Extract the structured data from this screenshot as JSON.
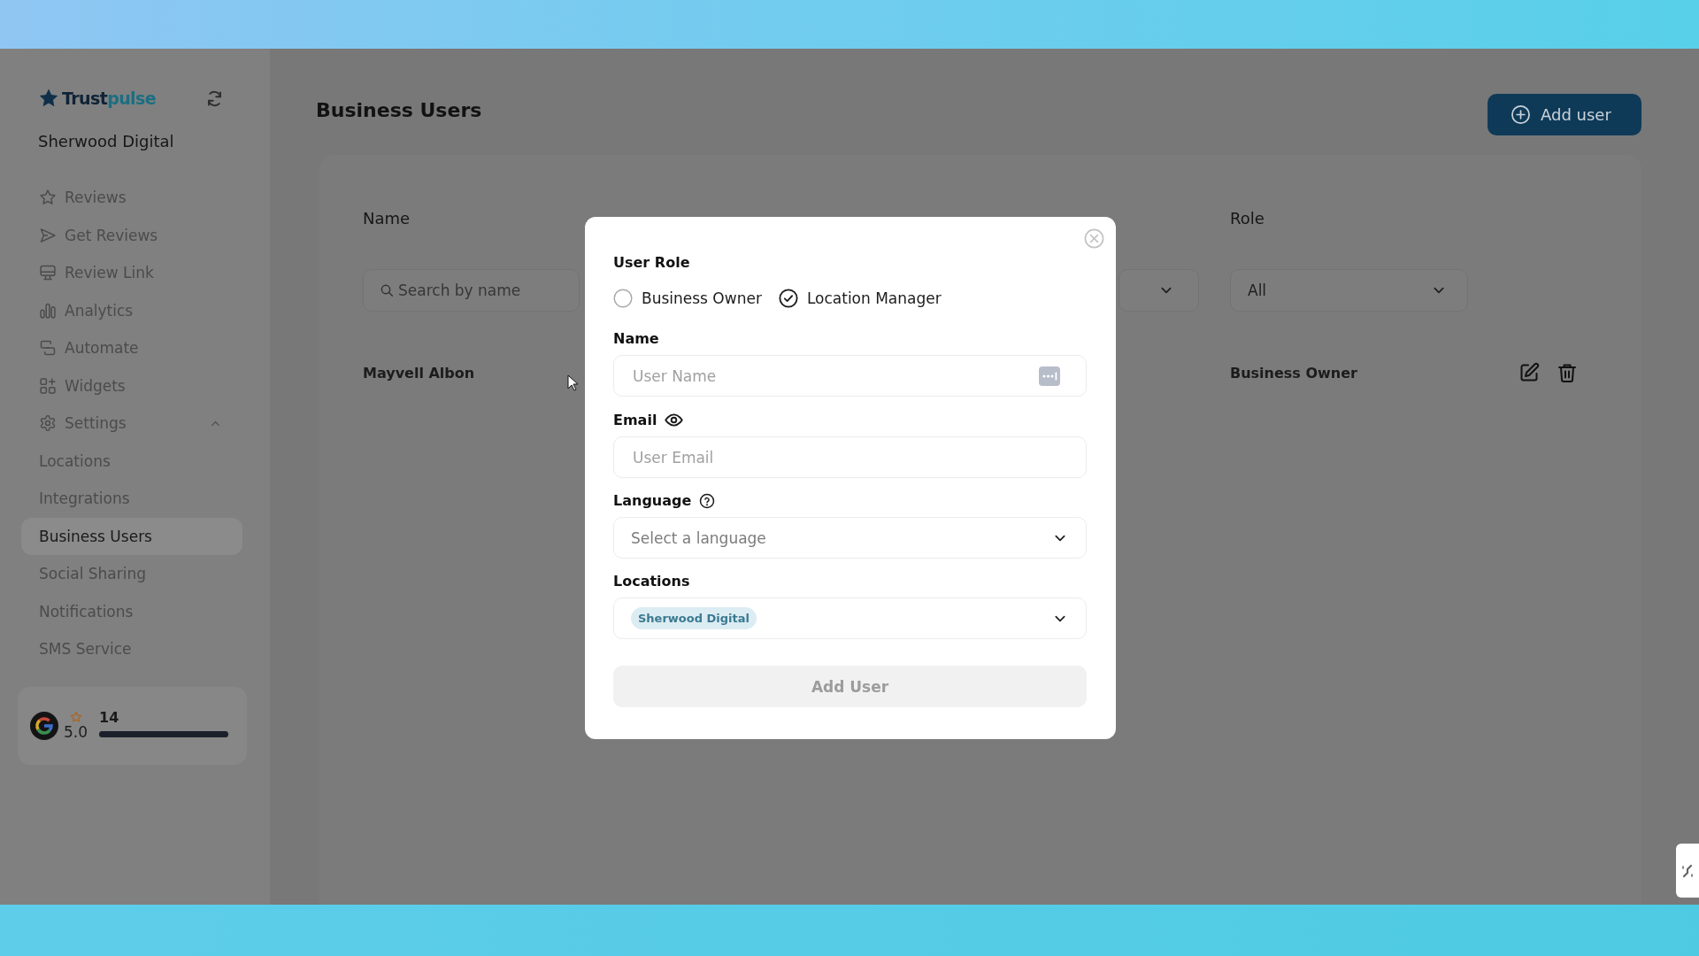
{
  "sidebar": {
    "logo": [
      "Trust",
      "pulse"
    ],
    "account": "Sherwood Digital",
    "items": [
      {
        "label": "Reviews",
        "selected": false
      },
      {
        "label": "Get Reviews",
        "selected": false
      },
      {
        "label": "Review Link",
        "selected": false
      },
      {
        "label": "Analytics",
        "selected": false
      },
      {
        "label": "Automate",
        "selected": false
      },
      {
        "label": "Widgets",
        "selected": false
      },
      {
        "label": "Settings",
        "selected": false,
        "expanded": true,
        "children": [
          {
            "label": "Locations",
            "selected": false
          },
          {
            "label": "Integrations",
            "selected": false
          },
          {
            "label": "Business Users",
            "selected": true
          },
          {
            "label": "Social Sharing",
            "selected": false
          },
          {
            "label": "Notifications",
            "selected": false
          },
          {
            "label": "SMS Service",
            "selected": false
          }
        ]
      }
    ],
    "rating_card": {
      "score": "5.0",
      "count": "14",
      "level": 1
    }
  },
  "page": {
    "title": "Business Users",
    "add_button": "Add user"
  },
  "table": {
    "columns": [
      "Name",
      "Role"
    ],
    "search": {
      "placeholder": "Search by name"
    },
    "role_filter": {
      "value": "All"
    },
    "rows": [
      {
        "name": "Mayvell Albon",
        "role": "Business Owner"
      }
    ]
  },
  "modal": {
    "role_label": "User Role",
    "roles": [
      {
        "label": "Business Owner",
        "selected": false
      },
      {
        "label": "Location Manager",
        "selected": true
      }
    ],
    "fields": [
      {
        "kind": "input",
        "label": "Name",
        "placeholder": "User Name"
      },
      {
        "kind": "input",
        "label": "Email",
        "placeholder": "User Email"
      },
      {
        "kind": "select",
        "label": "Language",
        "placeholder": "Select a language"
      },
      {
        "kind": "tags",
        "label": "Locations",
        "tags": [
          "Sherwood Digital"
        ]
      }
    ],
    "submit": {
      "label": "Add User",
      "disabled": true
    }
  }
}
